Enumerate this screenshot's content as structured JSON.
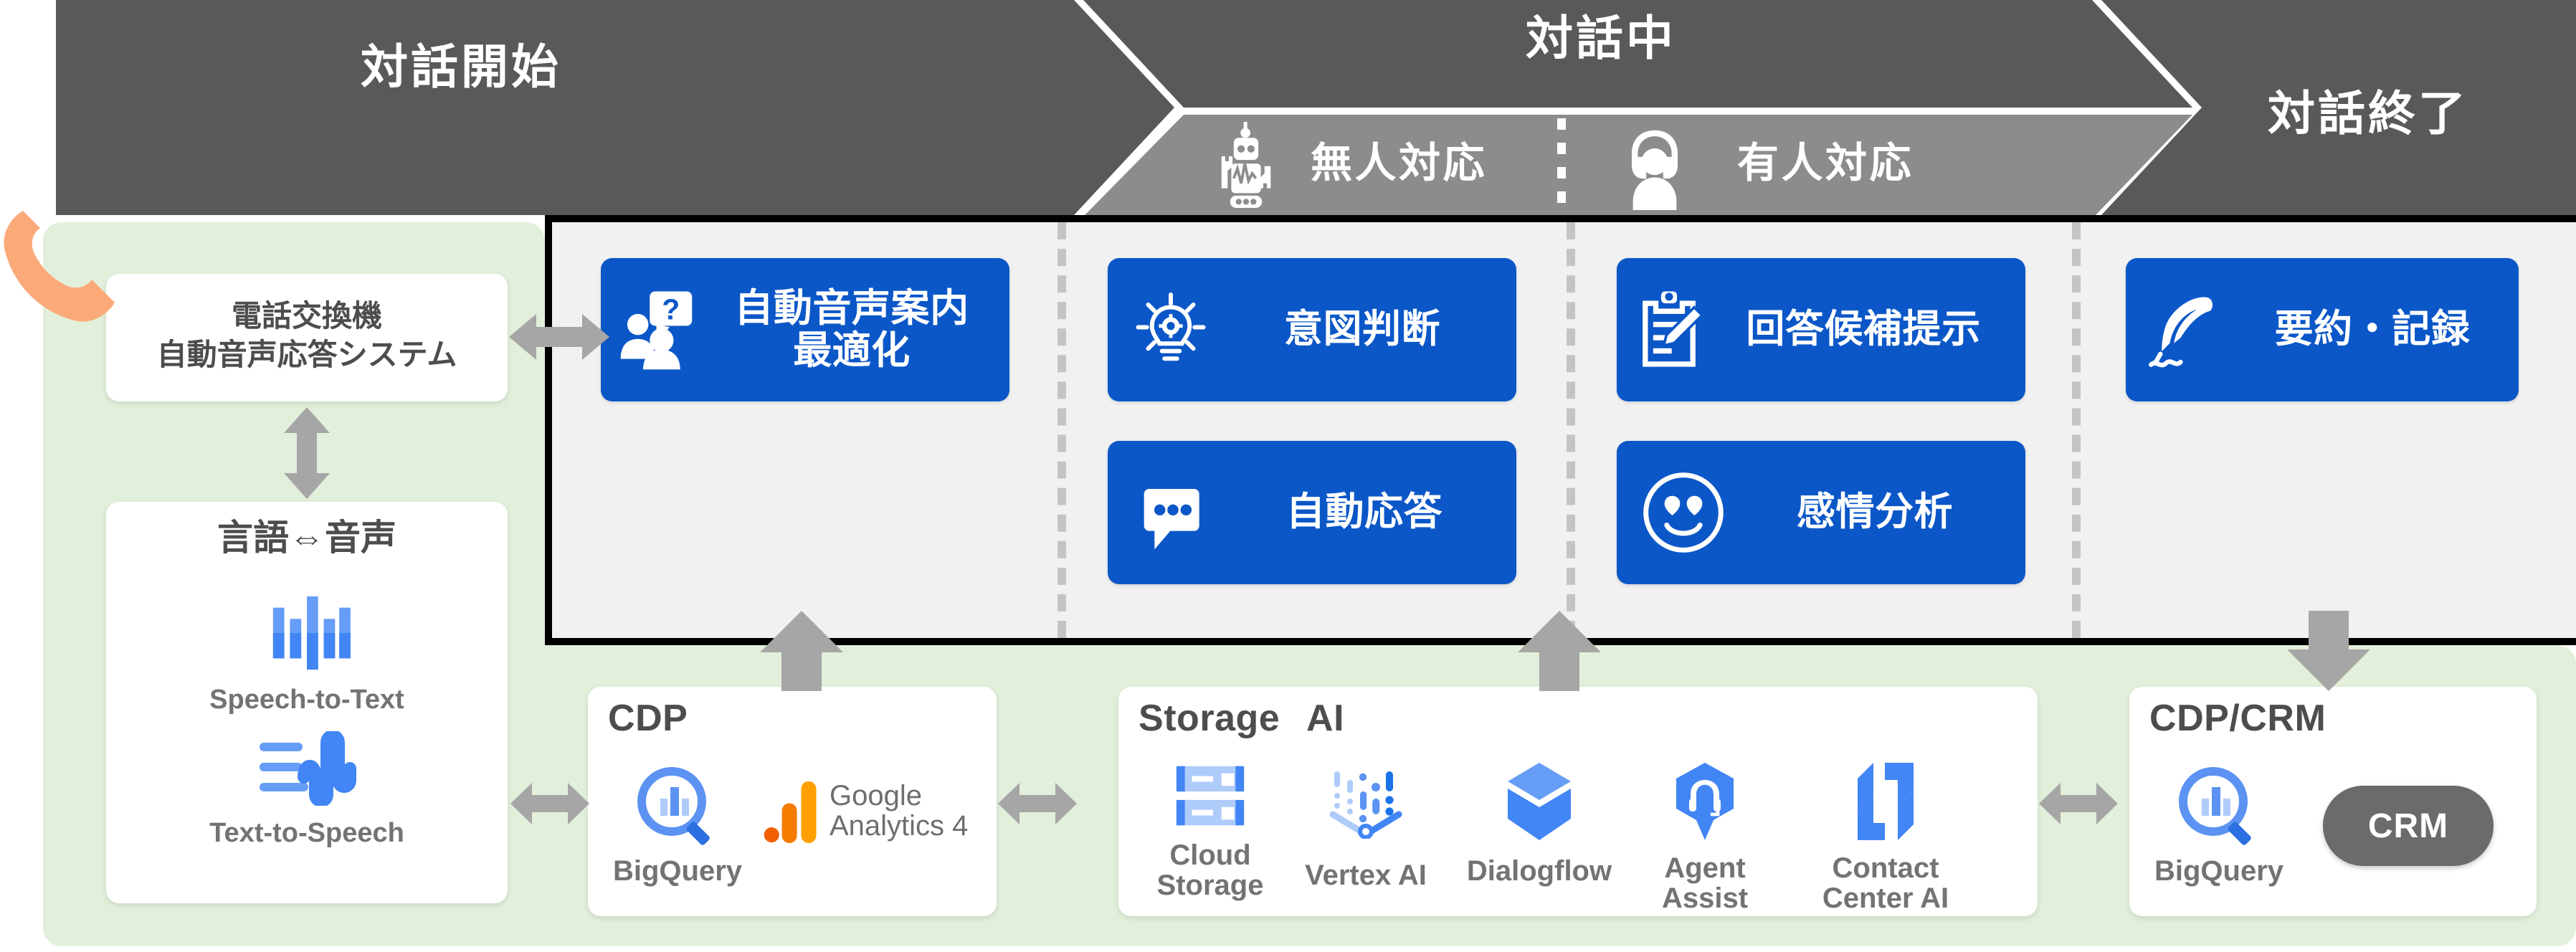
{
  "phases": [
    {
      "id": "start",
      "label": "対話開始"
    },
    {
      "id": "during",
      "label": "対話中"
    },
    {
      "id": "end",
      "label": "対話終了"
    }
  ],
  "sub_phases": [
    {
      "id": "unmanned",
      "label": "無人対応",
      "icon": "robot-icon"
    },
    {
      "id": "manned",
      "label": "有人対応",
      "icon": "headset-agent-icon"
    }
  ],
  "telephony": {
    "title": "電話交換機\n自動音声応答システム",
    "phone_icon": "phone-handset-icon"
  },
  "speech": {
    "title": "言語⇔音声",
    "items": [
      {
        "label": "Speech-to-Text",
        "icon": "speech-to-text-icon"
      },
      {
        "label": "Text-to-Speech",
        "icon": "text-to-speech-icon"
      }
    ]
  },
  "features": [
    {
      "id": "ivr-optimize",
      "label": "自動音声案内\n最適化",
      "icon": "people-question-icon",
      "font_size": 54
    },
    {
      "id": "intent",
      "label": "意図判断",
      "icon": "lightbulb-gear-icon",
      "font_size": 54
    },
    {
      "id": "answer-sugg",
      "label": "回答候補提示",
      "icon": "clipboard-pencil-icon",
      "font_size": 54
    },
    {
      "id": "summary",
      "label": "要約・記録",
      "icon": "quill-pen-icon",
      "font_size": 54
    },
    {
      "id": "auto-reply",
      "label": "自動応答",
      "icon": "chat-bubble-dots-icon",
      "font_size": 54
    },
    {
      "id": "sentiment",
      "label": "感情分析",
      "icon": "smiley-heart-eyes-icon",
      "font_size": 54
    }
  ],
  "infrastructure": [
    {
      "id": "cdp",
      "title": "CDP",
      "products": [
        {
          "label": "BigQuery",
          "icon": "bigquery-icon"
        },
        {
          "label": "Google\nAnalytics 4",
          "icon": "google-analytics-icon"
        }
      ]
    },
    {
      "id": "storage-ai",
      "titles": [
        "Storage",
        "AI"
      ],
      "products": [
        {
          "label": "Cloud\nStorage",
          "icon": "cloud-storage-icon"
        },
        {
          "label": "Vertex AI",
          "icon": "vertex-ai-icon"
        },
        {
          "label": "Dialogflow",
          "icon": "dialogflow-icon"
        },
        {
          "label": "Agent\nAssist",
          "icon": "agent-assist-icon"
        },
        {
          "label": "Contact\nCenter AI",
          "icon": "contact-center-ai-icon"
        }
      ]
    },
    {
      "id": "cdp-crm",
      "title": "CDP/CRM",
      "products": [
        {
          "label": "BigQuery",
          "icon": "bigquery-icon"
        }
      ],
      "pill": "CRM"
    }
  ],
  "colors": {
    "phase_dark": "#595959",
    "phase_light": "#8c8c8c",
    "feature_blue": "#0b57c8",
    "green_panel": "#e2efda",
    "stage_bg": "#f1f1f1",
    "arrow_gray": "#a6a6a6",
    "phone_orange": "#fca97a",
    "crm_gray": "#6b6b6b",
    "google_blue": "#4285f4",
    "ga_orange": "#f57c00",
    "ga_amber": "#ffa000"
  }
}
